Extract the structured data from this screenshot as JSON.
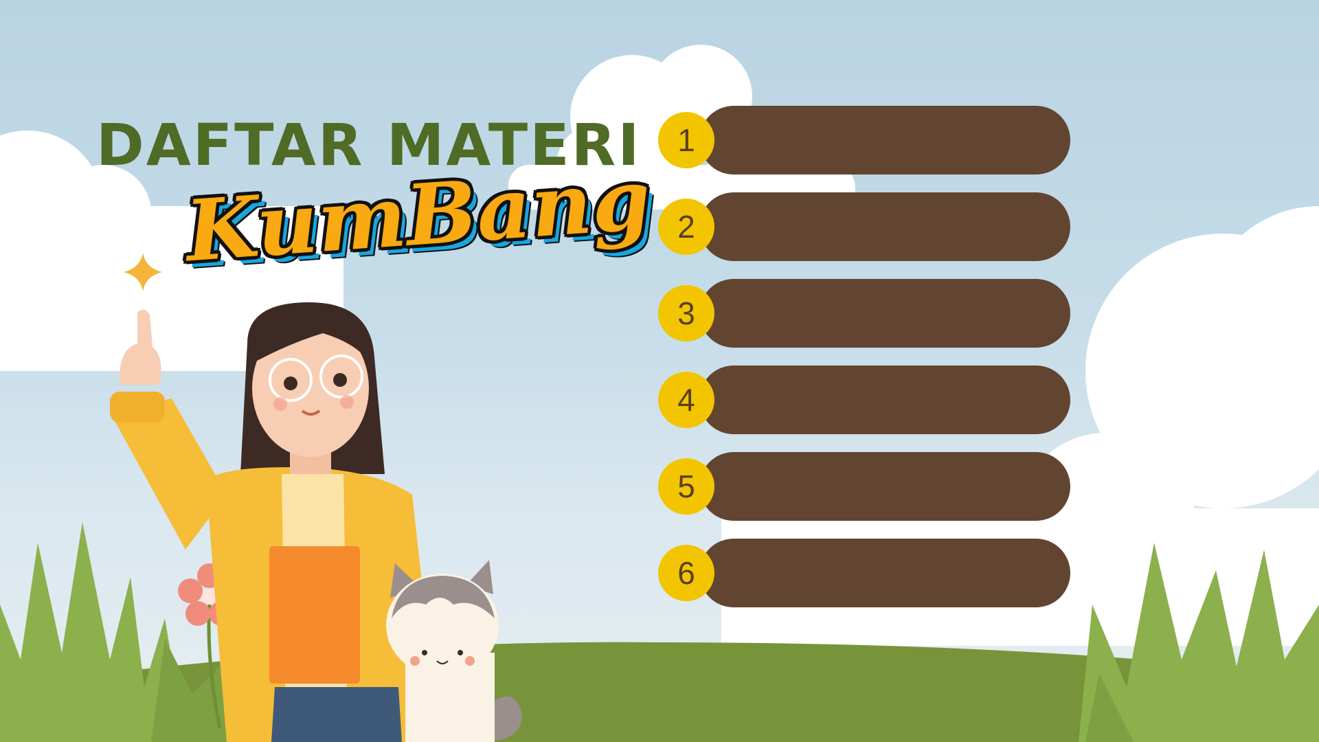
{
  "slide": {
    "title": "DAFTAR MATERI",
    "logo_text": "KumBang"
  },
  "menu": {
    "items": [
      {
        "number": "1",
        "label": ""
      },
      {
        "number": "2",
        "label": ""
      },
      {
        "number": "3",
        "label": ""
      },
      {
        "number": "4",
        "label": ""
      },
      {
        "number": "5",
        "label": ""
      },
      {
        "number": "6",
        "label": ""
      }
    ]
  },
  "colors": {
    "sky": "#c7dde9",
    "title_green": "#4f6b26",
    "bar_brown": "#624530",
    "number_yellow": "#f2c500",
    "grass_green": "#77943a",
    "logo_orange": "#f9a911"
  },
  "icons": {
    "sparkle": "sparkle-icon",
    "flower": "flower-icon"
  }
}
